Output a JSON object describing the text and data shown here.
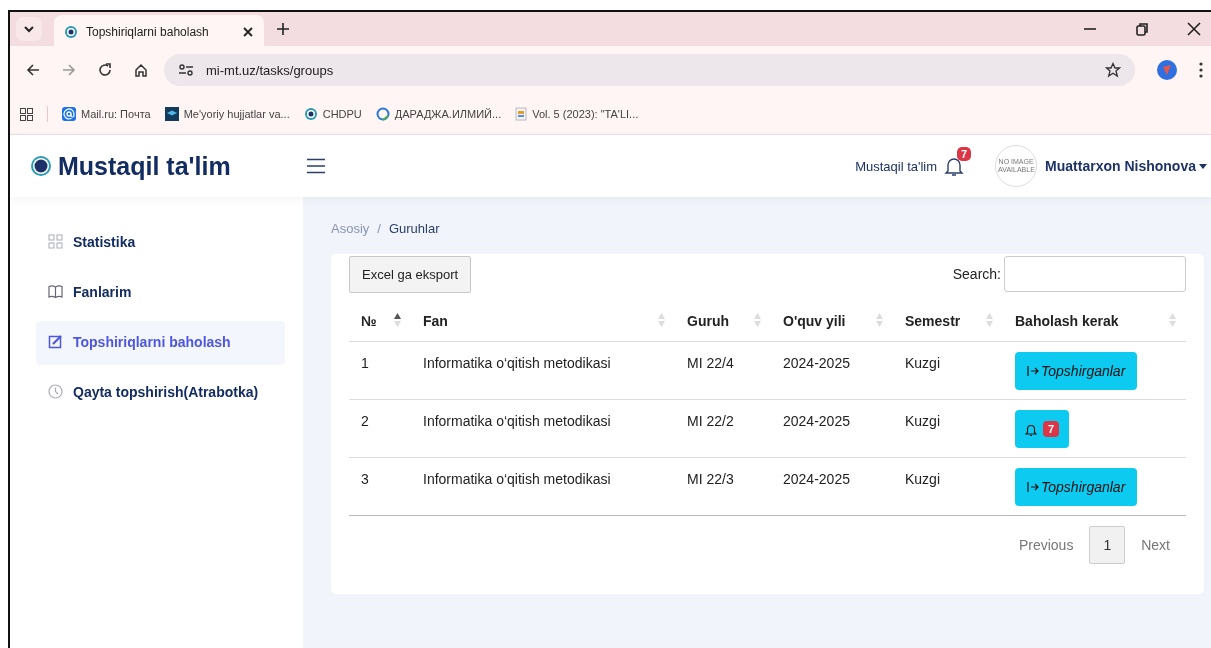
{
  "browser": {
    "tabs": [
      {
        "title": "Topshiriqlarni baholash",
        "selected": true
      }
    ],
    "address": "mi-mt.uz/tasks/groups",
    "bookmarks": [
      {
        "label": "Mail.ru: Почта",
        "kind": "at"
      },
      {
        "label": "Me'yoriy hujjatlar va...",
        "kind": "cap"
      },
      {
        "label": "CHDPU",
        "kind": "mt"
      },
      {
        "label": "ДАРАДЖА.ИЛМИЙ...",
        "kind": "globe"
      },
      {
        "label": "Vol. 5 (2023): \"TA'LI...",
        "kind": "doc"
      }
    ]
  },
  "header": {
    "brand": "Mustaqil ta'lim",
    "link": "Mustaqil ta'lim",
    "notifications": "7",
    "avatar": "NO IMAGE AVAILABLE",
    "user": "Muattarxon Nishonova"
  },
  "sidebar": {
    "items": [
      {
        "label": "Statistika",
        "selected": false
      },
      {
        "label": "Fanlarim",
        "selected": false
      },
      {
        "label": "Topshiriqlarni baholash",
        "selected": true
      },
      {
        "label": "Qayta topshirish(Atrabotka)",
        "selected": false
      }
    ]
  },
  "breadcrumb": {
    "separator": "/",
    "items": [
      {
        "label": "Asosiy",
        "current": false
      },
      {
        "label": "Guruhlar",
        "current": true
      }
    ]
  },
  "toolbar": {
    "export": "Excel ga eksport",
    "search_label": "Search:"
  },
  "table": {
    "columns": [
      {
        "label": "№",
        "sorted": true
      },
      {
        "label": "Fan",
        "sorted": false
      },
      {
        "label": "Guruh",
        "sorted": false
      },
      {
        "label": "O'quv yili",
        "sorted": false
      },
      {
        "label": "Semestr",
        "sorted": false
      },
      {
        "label": "Baholash kerak",
        "sorted": false
      }
    ],
    "rows": [
      {
        "cells": [
          "1",
          "Informatika o‘qitish metodikasi",
          "MI 22/4",
          "2024-2025",
          "Kuzgi"
        ],
        "action": {
          "kind": "link",
          "label": "Topshirganlar"
        }
      },
      {
        "cells": [
          "2",
          "Informatika o‘qitish metodikasi",
          "MI 22/2",
          "2024-2025",
          "Kuzgi"
        ],
        "action": {
          "kind": "notify",
          "count": "7"
        }
      },
      {
        "cells": [
          "3",
          "Informatika o‘qitish metodikasi",
          "MI 22/3",
          "2024-2025",
          "Kuzgi"
        ],
        "action": {
          "kind": "link",
          "label": "Topshirganlar"
        }
      }
    ]
  },
  "pagination": {
    "previous": "Previous",
    "pages": [
      {
        "label": "1",
        "selected": true
      }
    ],
    "next": "Next"
  }
}
